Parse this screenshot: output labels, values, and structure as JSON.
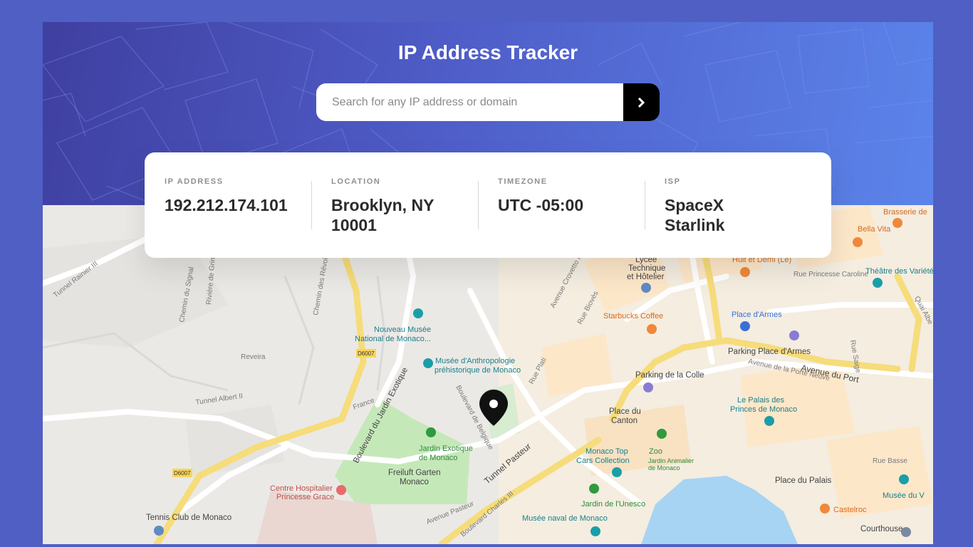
{
  "header": {
    "title": "IP Address Tracker"
  },
  "search": {
    "placeholder": "Search for any IP address or domain",
    "submit_icon": "chevron-right-icon"
  },
  "info": {
    "ip_address": {
      "label": "IP ADDRESS",
      "value": "192.212.174.101"
    },
    "location": {
      "label": "LOCATION",
      "value": "Brooklyn, NY 10001"
    },
    "timezone": {
      "label": "TIMEZONE",
      "value": "UTC -05:00"
    },
    "isp": {
      "label": "ISP",
      "value": "SpaceX Starlink"
    }
  },
  "map": {
    "marker_icon": "location-pin-icon",
    "labels": {
      "tunnel_rainier": "Tunnel Rainier III",
      "chemin_signal": "Chemin du Signal",
      "riviere_grima": "Rivière de Grima",
      "chemin_revoires": "Chemin des Révoires",
      "nouveau_musee": "Nouveau Musée",
      "national_monaco": "National de Monaco...",
      "musee_anthropologie": "Musée d'Anthropologie",
      "prehistorique": "préhistorique de Monaco",
      "lycee": "Lycée",
      "technique": "Technique",
      "hotelier": "et Hôtelier",
      "starbucks": "Starbucks Coffee",
      "place_armes": "Place d'Armes",
      "parking_place_armes": "Parking Place d'Armes",
      "avenue_port": "Avenue du Port",
      "parking_colle": "Parking de la Colle",
      "palais_princes": "Le Palais des",
      "princes_monaco": "Princes de Monaco",
      "place_canton": "Place du",
      "canton": "Canton",
      "jardin_exotique": "Jardin Exotique",
      "de_monaco": "de Monaco",
      "freiluft_garten": "Freiluft Garten",
      "monaco": "Monaco",
      "boulevard_jardin": "Boulevard du Jardin Exotique",
      "tunnel_pasteur": "Tunnel Pasteur",
      "centre_hospitalier": "Centre Hospitalier",
      "princesse_grace": "Princesse Grace",
      "tennis_club": "Tennis Club de Monaco",
      "monaco_top_cars": "Monaco Top",
      "cars_collection": "Cars Collection",
      "zoo": "Zoo",
      "jardin_animalier": "Jardin Animalier",
      "jardin_animalier_2": "de Monaco",
      "jardin_unesco": "Jardin de l'Unesco",
      "musee_naval": "Musée naval de Monaco",
      "place_palais": "Place du Palais",
      "castelroc": "Castelroc",
      "courthouse": "Courthouse",
      "bella_vita": "Bella Vita",
      "brasserie": "Brasserie de",
      "huit_demi": "Huit et Demi (Le)",
      "rue_princesse": "Rue Princesse Caroline",
      "theatre": "Théâtre des Variété",
      "rue_basse": "Rue Basse",
      "musee_vieux": "Musée du V",
      "reveira": "Reveira",
      "tunnel_albert": "Tunnel Albert II",
      "d6007a": "D6007",
      "d6007b": "D6007",
      "france": "France",
      "boulevard_belgique": "Boulevard de Belgique",
      "boulevard_charles": "Boulevard Charles III",
      "avenue_pasteur": "Avenue Pasteur",
      "avenue_prince": "Avenue de la Porte Neuve",
      "rue_plati": "Rue Plati",
      "rue_biovès": "Rue Biovès",
      "avenue_crovetto": "Avenue Crovetto Frères",
      "quai_albert": "Quai Albe",
      "rue_saige": "Rue Saige"
    }
  }
}
